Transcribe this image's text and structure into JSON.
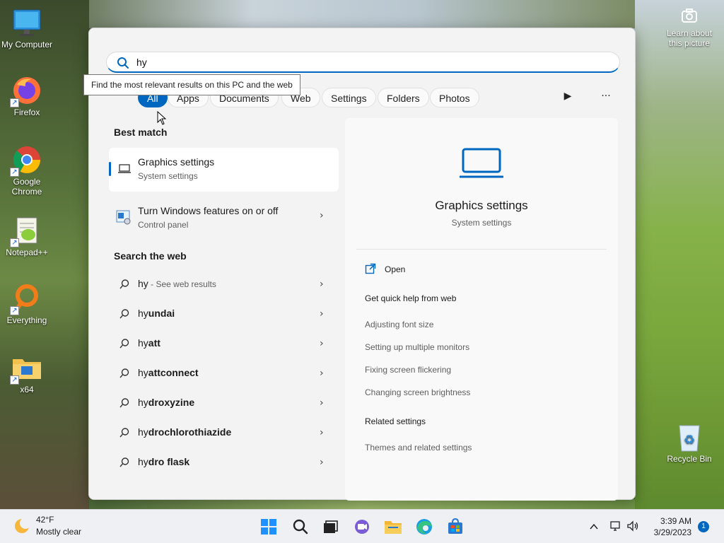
{
  "desktop": {
    "icons": [
      {
        "label": "My Computer"
      },
      {
        "label": "Firefox"
      },
      {
        "label": "Google Chrome"
      },
      {
        "label": "Notepad++"
      },
      {
        "label": "Everything"
      },
      {
        "label": "x64"
      },
      {
        "label": "Recycle Bin"
      }
    ],
    "spotlight": {
      "label": "Learn about this picture"
    }
  },
  "search": {
    "value": "hy",
    "tooltip": "Find the most relevant results on this PC and the web",
    "filters": [
      "All",
      "Apps",
      "Documents",
      "Web",
      "Settings",
      "Folders",
      "Photos"
    ],
    "active_filter": "All"
  },
  "results": {
    "best_match_title": "Best match",
    "best_match": {
      "title": "Graphics settings",
      "subtitle": "System settings"
    },
    "second": {
      "title": "Turn Windows features on or off",
      "subtitle": "Control panel"
    },
    "web_title": "Search the web",
    "web_first": {
      "query": "hy",
      "hint": " - See web results"
    },
    "web_items": [
      {
        "prefix": "hy",
        "suffix": "undai"
      },
      {
        "prefix": "hy",
        "suffix": "att"
      },
      {
        "prefix": "hy",
        "suffix": "attconnect"
      },
      {
        "prefix": "hy",
        "suffix": "droxyzine"
      },
      {
        "prefix": "hy",
        "suffix": "drochlorothiazide"
      },
      {
        "prefix": "hy",
        "suffix": "dro flask"
      }
    ]
  },
  "preview": {
    "title": "Graphics settings",
    "subtitle": "System settings",
    "open_label": "Open",
    "help_title": "Get quick help from web",
    "help_links": [
      "Adjusting font size",
      "Setting up multiple monitors",
      "Fixing screen flickering",
      "Changing screen brightness"
    ],
    "related_title": "Related settings",
    "related_links": [
      "Themes and related settings"
    ]
  },
  "taskbar": {
    "weather_temp": "42°F",
    "weather_desc": "Mostly clear",
    "time": "3:39 AM",
    "date": "3/29/2023",
    "notifications": "1"
  },
  "colors": {
    "accent": "#0067c0"
  }
}
